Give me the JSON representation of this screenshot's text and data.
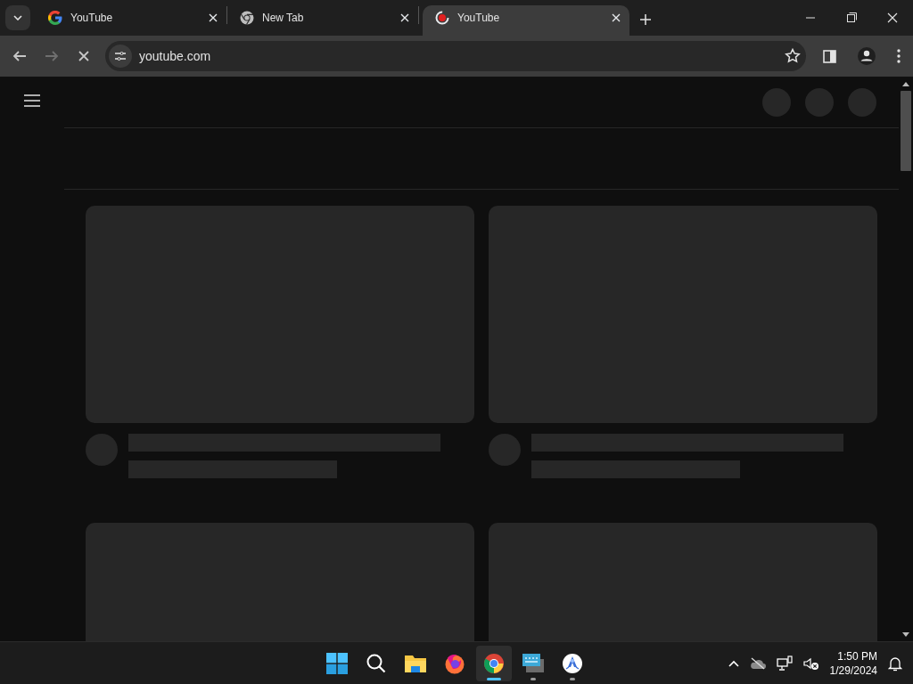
{
  "tabs": [
    {
      "title": "YouTube",
      "kind": "google",
      "selected": false
    },
    {
      "title": "New Tab",
      "kind": "chrome",
      "selected": false
    },
    {
      "title": "YouTube",
      "kind": "loading",
      "selected": true
    }
  ],
  "toolbar": {
    "back_disabled": false,
    "forward_disabled": true,
    "address": "youtube.com",
    "loading": true
  },
  "taskbar": {
    "apps": [
      {
        "kind": "start",
        "running": false,
        "selected": false
      },
      {
        "kind": "search",
        "running": false,
        "selected": false
      },
      {
        "kind": "files",
        "running": false,
        "selected": false
      },
      {
        "kind": "firefox",
        "running": false,
        "selected": false
      },
      {
        "kind": "chrome",
        "running": true,
        "selected": true
      },
      {
        "kind": "terminal",
        "running": true,
        "selected": false
      },
      {
        "kind": "assistant",
        "running": true,
        "selected": false
      }
    ],
    "time": "1:50 PM",
    "date": "1/29/2024"
  }
}
